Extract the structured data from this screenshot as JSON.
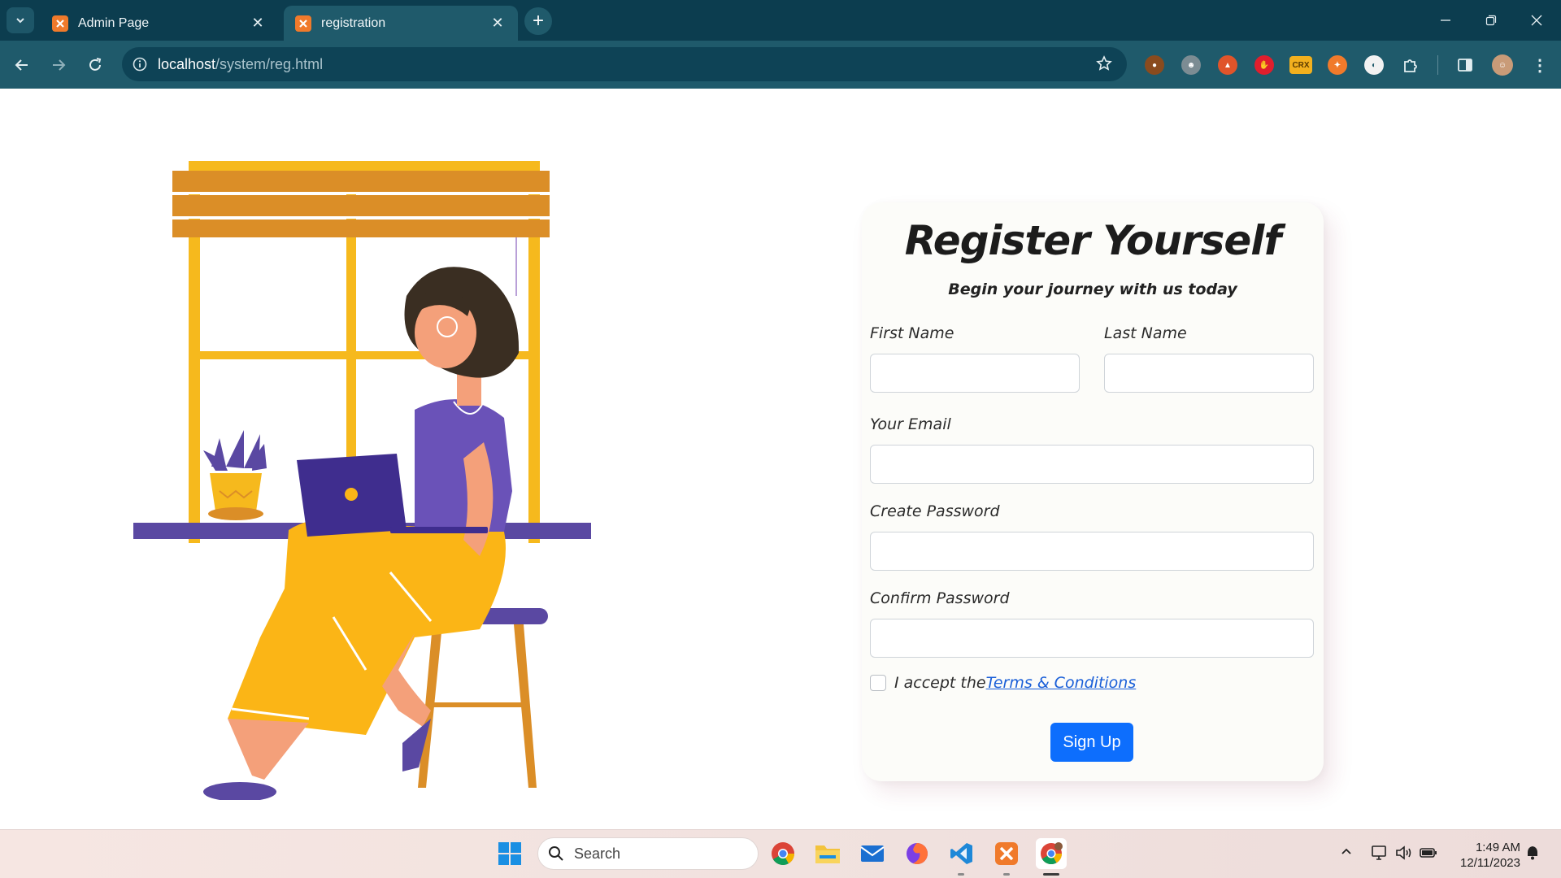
{
  "browser": {
    "tabs": [
      {
        "title": "Admin Page",
        "active": false
      },
      {
        "title": "registration",
        "active": true
      }
    ],
    "url_host": "localhost",
    "url_path": "/system/reg.html",
    "extension_icons": [
      "cookie-icon",
      "ghost-icon",
      "flame-icon",
      "stop-hand-icon",
      "crx-icon",
      "rocket-icon",
      "shield-icon",
      "puzzle-icon"
    ],
    "crx_label": "CRX"
  },
  "form": {
    "title": "Register Yourself",
    "subtitle": "Begin your journey with us today",
    "first_name_label": "First Name",
    "last_name_label": "Last Name",
    "email_label": "Your Email",
    "password_label": "Create Password",
    "confirm_label": "Confirm Password",
    "first_name_value": "",
    "last_name_value": "",
    "email_value": "",
    "password_value": "",
    "confirm_value": "",
    "terms_prefix": "I accept the",
    "terms_link": "Terms & Conditions",
    "terms_checked": false,
    "submit_label": "Sign Up",
    "accent_color": "#0d6efd"
  },
  "taskbar": {
    "search_placeholder": "Search",
    "time": "1:49 AM",
    "date": "12/11/2023",
    "apps": [
      "start-icon",
      "chrome-icon",
      "file-explorer-icon",
      "mail-icon",
      "firefox-icon",
      "vscode-icon",
      "xampp-icon",
      "chrome-profile-icon"
    ]
  }
}
